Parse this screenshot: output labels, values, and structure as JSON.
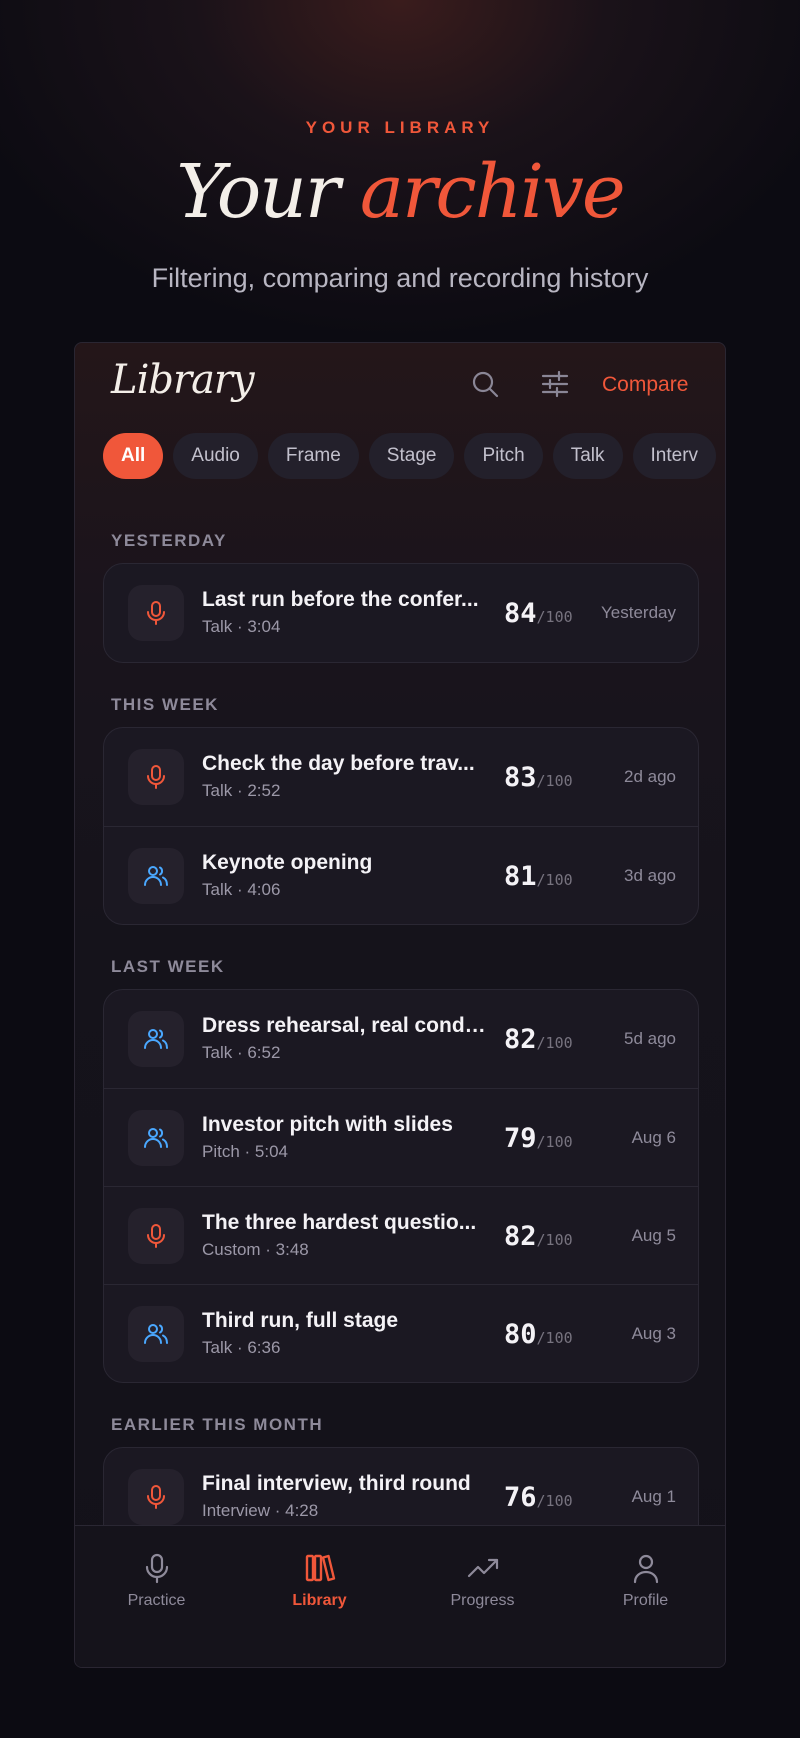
{
  "hero": {
    "eyebrow": "YOUR LIBRARY",
    "title_part1": "Your",
    "title_part2": "archive",
    "subtitle": "Filtering, comparing and recording history"
  },
  "header": {
    "title": "Library",
    "search_icon": "search-icon",
    "filter_icon": "sliders-icon",
    "compare_label": "Compare"
  },
  "filters": {
    "selected": "All",
    "chips": [
      "All",
      "Audio",
      "Frame",
      "Stage",
      "Pitch",
      "Talk",
      "Interv"
    ]
  },
  "sections": [
    {
      "label": "YESTERDAY",
      "items": [
        {
          "icon": "mic-icon",
          "title": "Last run before the confer...",
          "meta": "Talk · 3:04",
          "score": "84",
          "out_of": "/100",
          "date": "Yesterday"
        }
      ]
    },
    {
      "label": "THIS WEEK",
      "items": [
        {
          "icon": "mic-icon",
          "title": "Check the day before trav...",
          "meta": "Talk · 2:52",
          "score": "83",
          "out_of": "/100",
          "date": "2d ago"
        },
        {
          "icon": "people-icon",
          "title": "Keynote opening",
          "meta": "Talk · 4:06",
          "score": "81",
          "out_of": "/100",
          "date": "3d ago"
        }
      ]
    },
    {
      "label": "LAST WEEK",
      "items": [
        {
          "icon": "people-icon",
          "title": "Dress rehearsal, real condi...",
          "meta": "Talk · 6:52",
          "score": "82",
          "out_of": "/100",
          "date": "5d ago"
        },
        {
          "icon": "people-icon",
          "title": "Investor pitch with slides",
          "meta": "Pitch · 5:04",
          "score": "79",
          "out_of": "/100",
          "date": "Aug 6"
        },
        {
          "icon": "mic-icon",
          "title": "The three hardest questio...",
          "meta": "Custom · 3:48",
          "score": "82",
          "out_of": "/100",
          "date": "Aug 5"
        },
        {
          "icon": "people-icon",
          "title": "Third run, full stage",
          "meta": "Talk · 6:36",
          "score": "80",
          "out_of": "/100",
          "date": "Aug 3"
        }
      ]
    },
    {
      "label": "EARLIER THIS MONTH",
      "items": [
        {
          "icon": "mic-icon",
          "title": "Final interview, third round",
          "meta": "Interview · 4:28",
          "score": "76",
          "out_of": "/100",
          "date": "Aug 1"
        }
      ]
    }
  ],
  "tabbar": {
    "active": "Library",
    "tabs": [
      {
        "label": "Practice",
        "icon": "mic-icon"
      },
      {
        "label": "Library",
        "icon": "books-icon"
      },
      {
        "label": "Progress",
        "icon": "trend-icon"
      },
      {
        "label": "Profile",
        "icon": "person-icon"
      }
    ]
  },
  "colors": {
    "accent": "#f0573a",
    "mic_icon": "#f0573a",
    "people_icon": "#4aa8ff",
    "background": "#0c0b12"
  }
}
